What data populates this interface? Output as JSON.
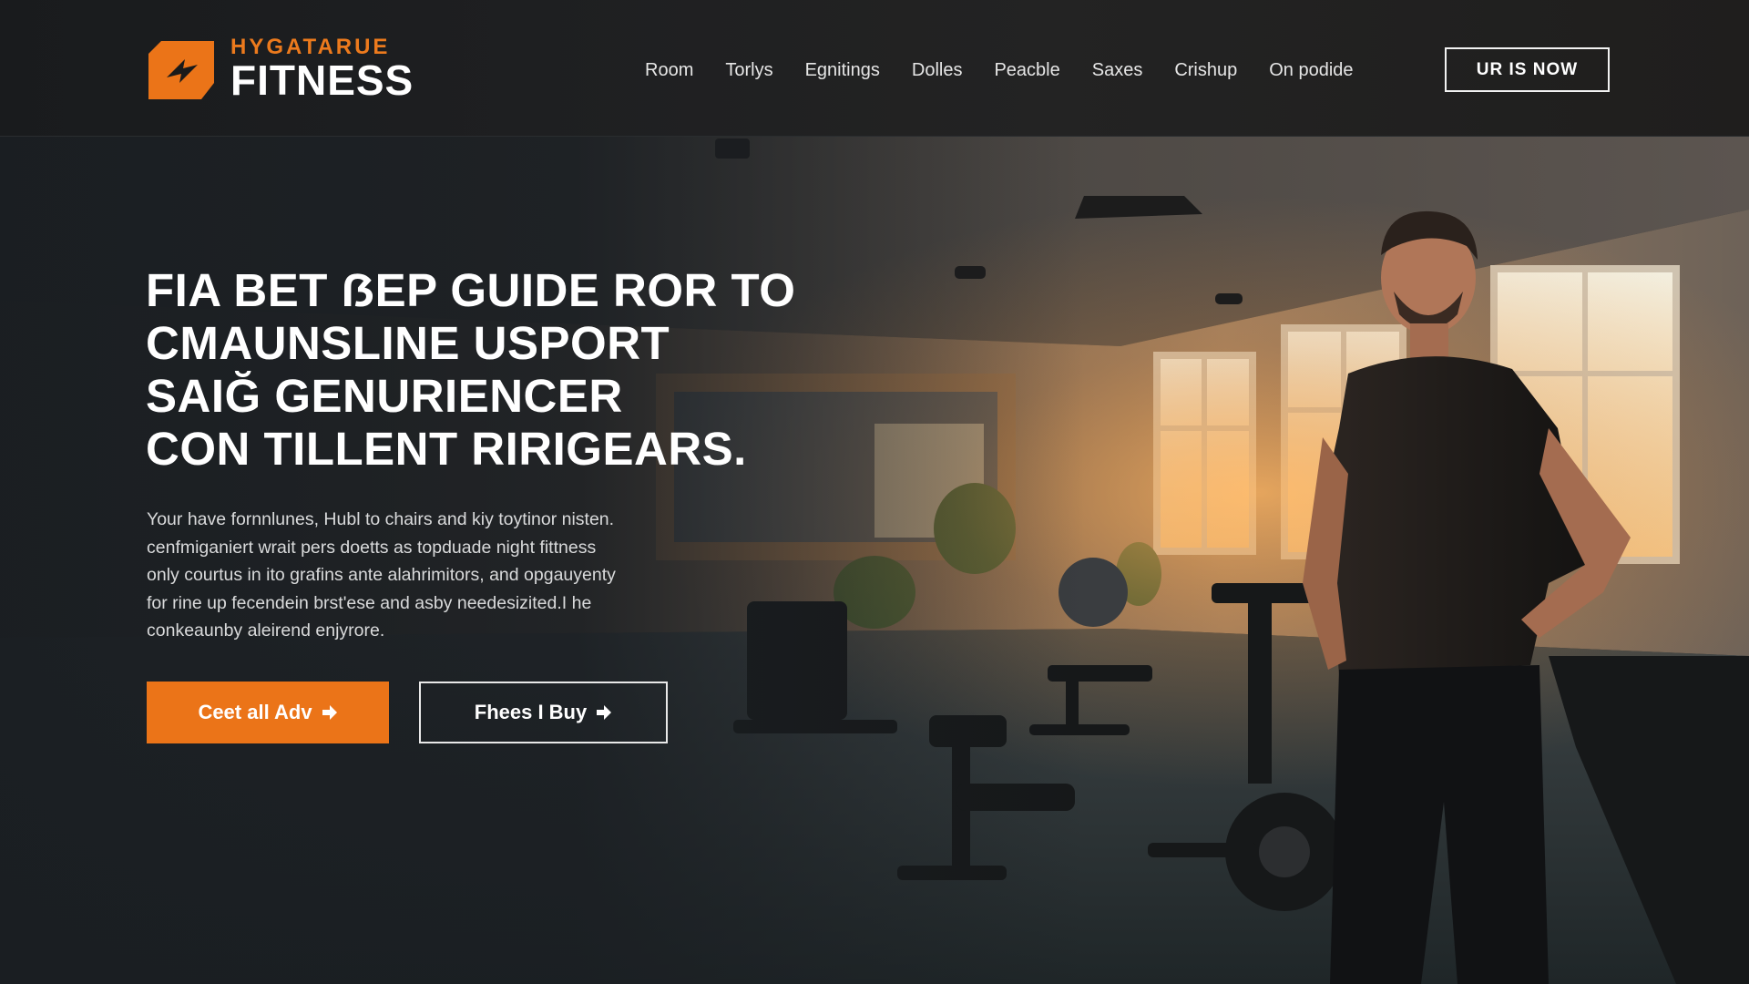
{
  "brand": {
    "tagline": "HYGATARUE",
    "name": "FITNESS",
    "accent_color": "#eb7418",
    "logo_icon": "arrow-bolt-logo-icon"
  },
  "nav": {
    "items": [
      {
        "label": "Room"
      },
      {
        "label": "Torlys"
      },
      {
        "label": "Egnitings"
      },
      {
        "label": "Dolles"
      },
      {
        "label": "Peacble"
      },
      {
        "label": "Saxes"
      },
      {
        "label": "Crishup"
      },
      {
        "label": "On podide"
      }
    ],
    "cta_label": "UR IS NOW"
  },
  "hero": {
    "title_lines": [
      "FIA BET ẞEP GUIDE ROR TO",
      "CMAUNSLINE USPORT",
      "SAIĞ GENURIENCER",
      "CON TILLENT RIRIGEARS."
    ],
    "description_lines": [
      "Your have fornnlunes, Hubl to chairs and kiy toytinor nisten.",
      "cenfmiganiert wrait pers doetts as topduade night fittness",
      "only courtus in ito grafins ante alahrimitors, and opgauyenty",
      "for rine up fecendein brst'ese and asby needesizited.I he",
      "conkeaunby aleirend enjyrore."
    ],
    "primary_button": "Ceet all Adv",
    "secondary_button": "Fhees I Buy",
    "arrow_icon": "arrow-right-icon"
  },
  "colors": {
    "header_bg": "#1e1f21",
    "hero_overlay": "#1a1e22",
    "button_orange": "#eb7418",
    "text_white": "#ffffff"
  }
}
